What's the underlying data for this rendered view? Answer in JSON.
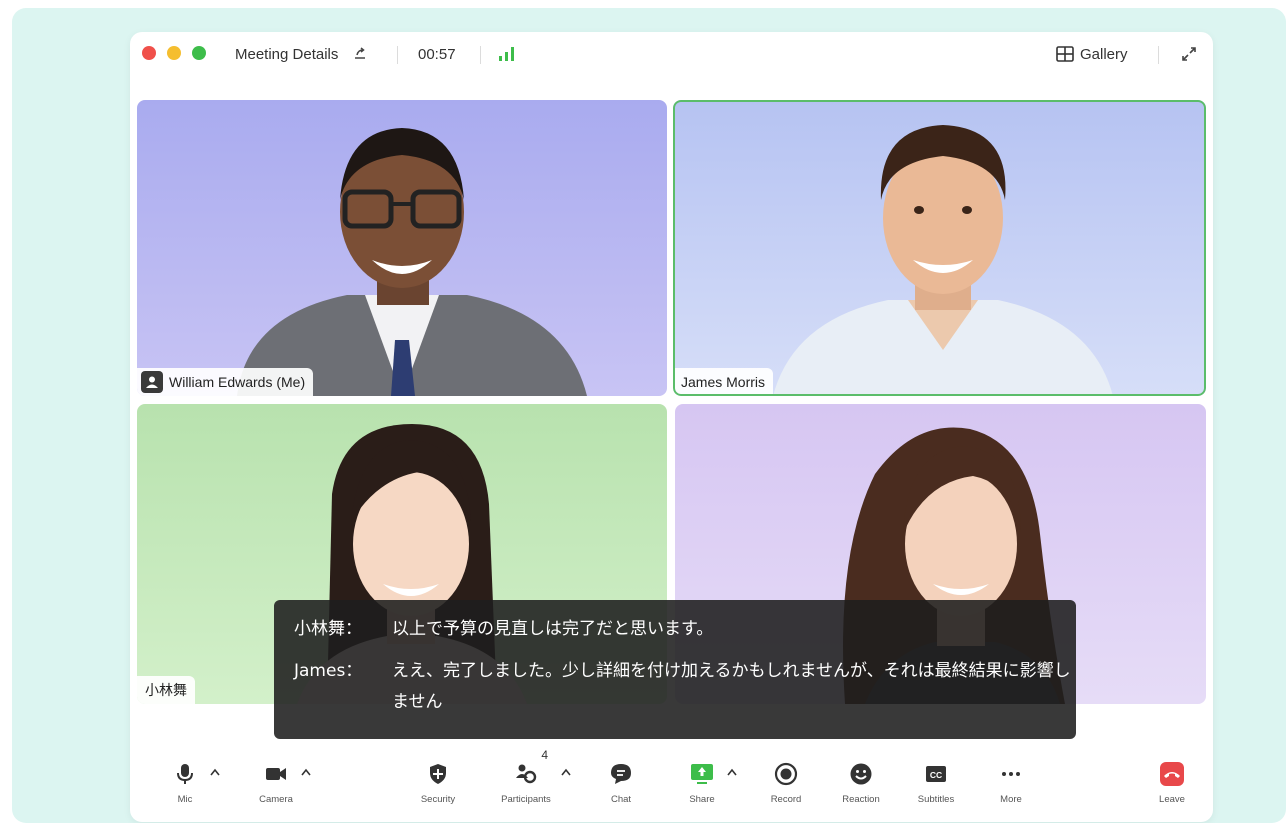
{
  "window": {
    "title": "Meeting Details",
    "timer": "00:57",
    "view_label": "Gallery"
  },
  "colors": {
    "close": "#f0504a",
    "minimize": "#f5be2f",
    "maximize": "#3dbd4a",
    "active_speaker_border": "#5bbd6a",
    "signal": "#3dbd4a",
    "leave": "#e8484a"
  },
  "participants": [
    {
      "name": "William Edwards (Me)",
      "background": "#b8b8f0"
    },
    {
      "name": "James Morris",
      "background": "#c2d0f6",
      "active": true
    },
    {
      "name": "小林舞",
      "background": "#c2e8b8"
    },
    {
      "name": "",
      "background": "#dcd0f4"
    }
  ],
  "subtitles": [
    {
      "speaker": "小林舞：",
      "text": "以上で予算の見直しは完了だと思います。"
    },
    {
      "speaker": "James：",
      "text": "ええ、完了しました。少し詳細を付け加えるかもしれませんが、それは最終結果に影響しません"
    }
  ],
  "toolbar": {
    "mic": "Mic",
    "camera": "Camera",
    "security": "Security",
    "participants": "Participants",
    "participants_count": "4",
    "chat": "Chat",
    "share": "Share",
    "record": "Record",
    "reaction": "Reaction",
    "subtitles": "Subtitles",
    "more": "More",
    "leave": "Leave"
  }
}
